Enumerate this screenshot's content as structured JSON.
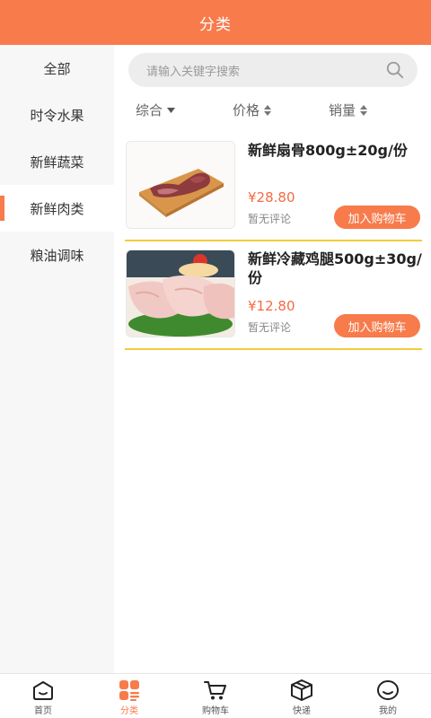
{
  "header": {
    "title": "分类"
  },
  "sidebar": {
    "items": [
      {
        "label": "全部"
      },
      {
        "label": "时令水果"
      },
      {
        "label": "新鲜蔬菜"
      },
      {
        "label": "新鲜肉类",
        "active": true
      },
      {
        "label": "粮油调味"
      }
    ]
  },
  "search": {
    "placeholder": "请输入关键字搜索",
    "icon": "search-icon"
  },
  "sort": {
    "items": [
      {
        "label": "综合",
        "icon": "caret-down-icon"
      },
      {
        "label": "价格",
        "icon": "sort-updown-icon"
      },
      {
        "label": "销量",
        "icon": "sort-updown-icon"
      }
    ]
  },
  "products": [
    {
      "name": "新鲜扇骨800g±20g/份",
      "price": "¥28.80",
      "comment": "暂无评论",
      "button": "加入购物车"
    },
    {
      "name": "新鲜冷藏鸡腿500g±30g/份",
      "price": "¥12.80",
      "comment": "暂无评论",
      "button": "加入购物车"
    }
  ],
  "tabbar": {
    "items": [
      {
        "label": "首页",
        "icon": "home-icon"
      },
      {
        "label": "分类",
        "icon": "category-icon",
        "active": true
      },
      {
        "label": "购物车",
        "icon": "cart-icon"
      },
      {
        "label": "快递",
        "icon": "package-icon"
      },
      {
        "label": "我的",
        "icon": "profile-icon"
      }
    ]
  },
  "colors": {
    "accent": "#f77b4b",
    "price": "#f46b44",
    "divider": "#f2cc3a"
  }
}
